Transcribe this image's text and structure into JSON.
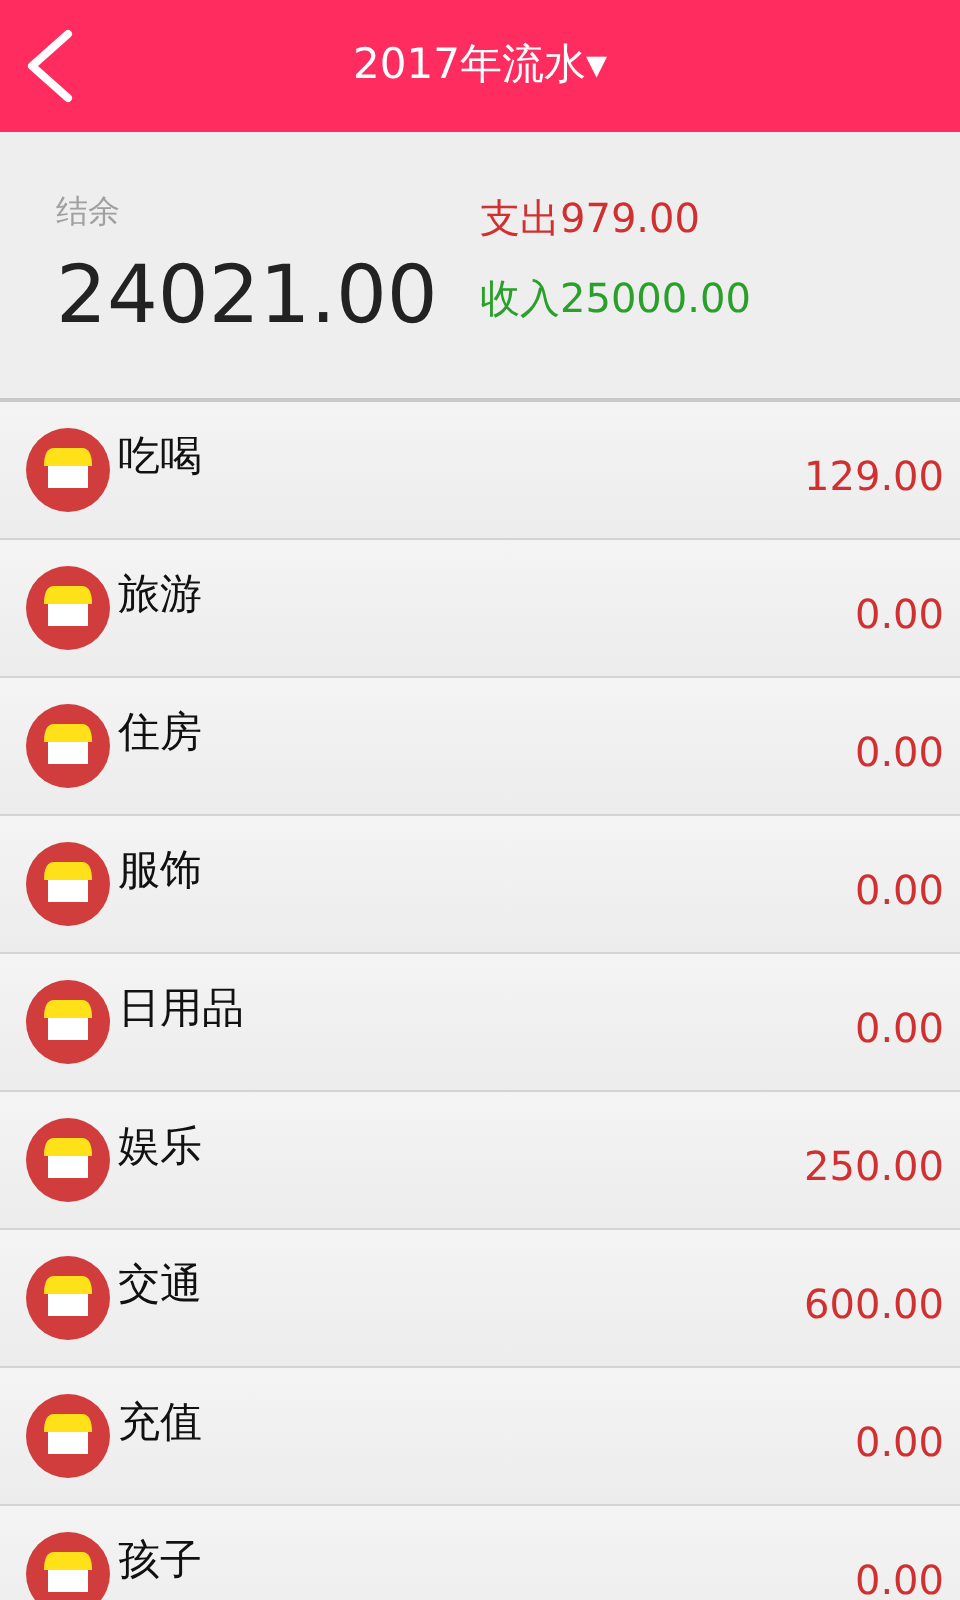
{
  "header": {
    "title": "2017年流水",
    "dropdown_arrow": "▾"
  },
  "summary": {
    "balance_label": "结余",
    "balance": "24021.00",
    "expense": "支出979.00",
    "income": "收入25000.00"
  },
  "categories": [
    {
      "name": "吃喝",
      "amount": "129.00"
    },
    {
      "name": "旅游",
      "amount": "0.00"
    },
    {
      "name": "住房",
      "amount": "0.00"
    },
    {
      "name": "服饰",
      "amount": "0.00"
    },
    {
      "name": "日用品",
      "amount": "0.00"
    },
    {
      "name": "娱乐",
      "amount": "250.00"
    },
    {
      "name": "交通",
      "amount": "600.00"
    },
    {
      "name": "充值",
      "amount": "0.00"
    },
    {
      "name": "孩子",
      "amount": "0.00"
    }
  ]
}
